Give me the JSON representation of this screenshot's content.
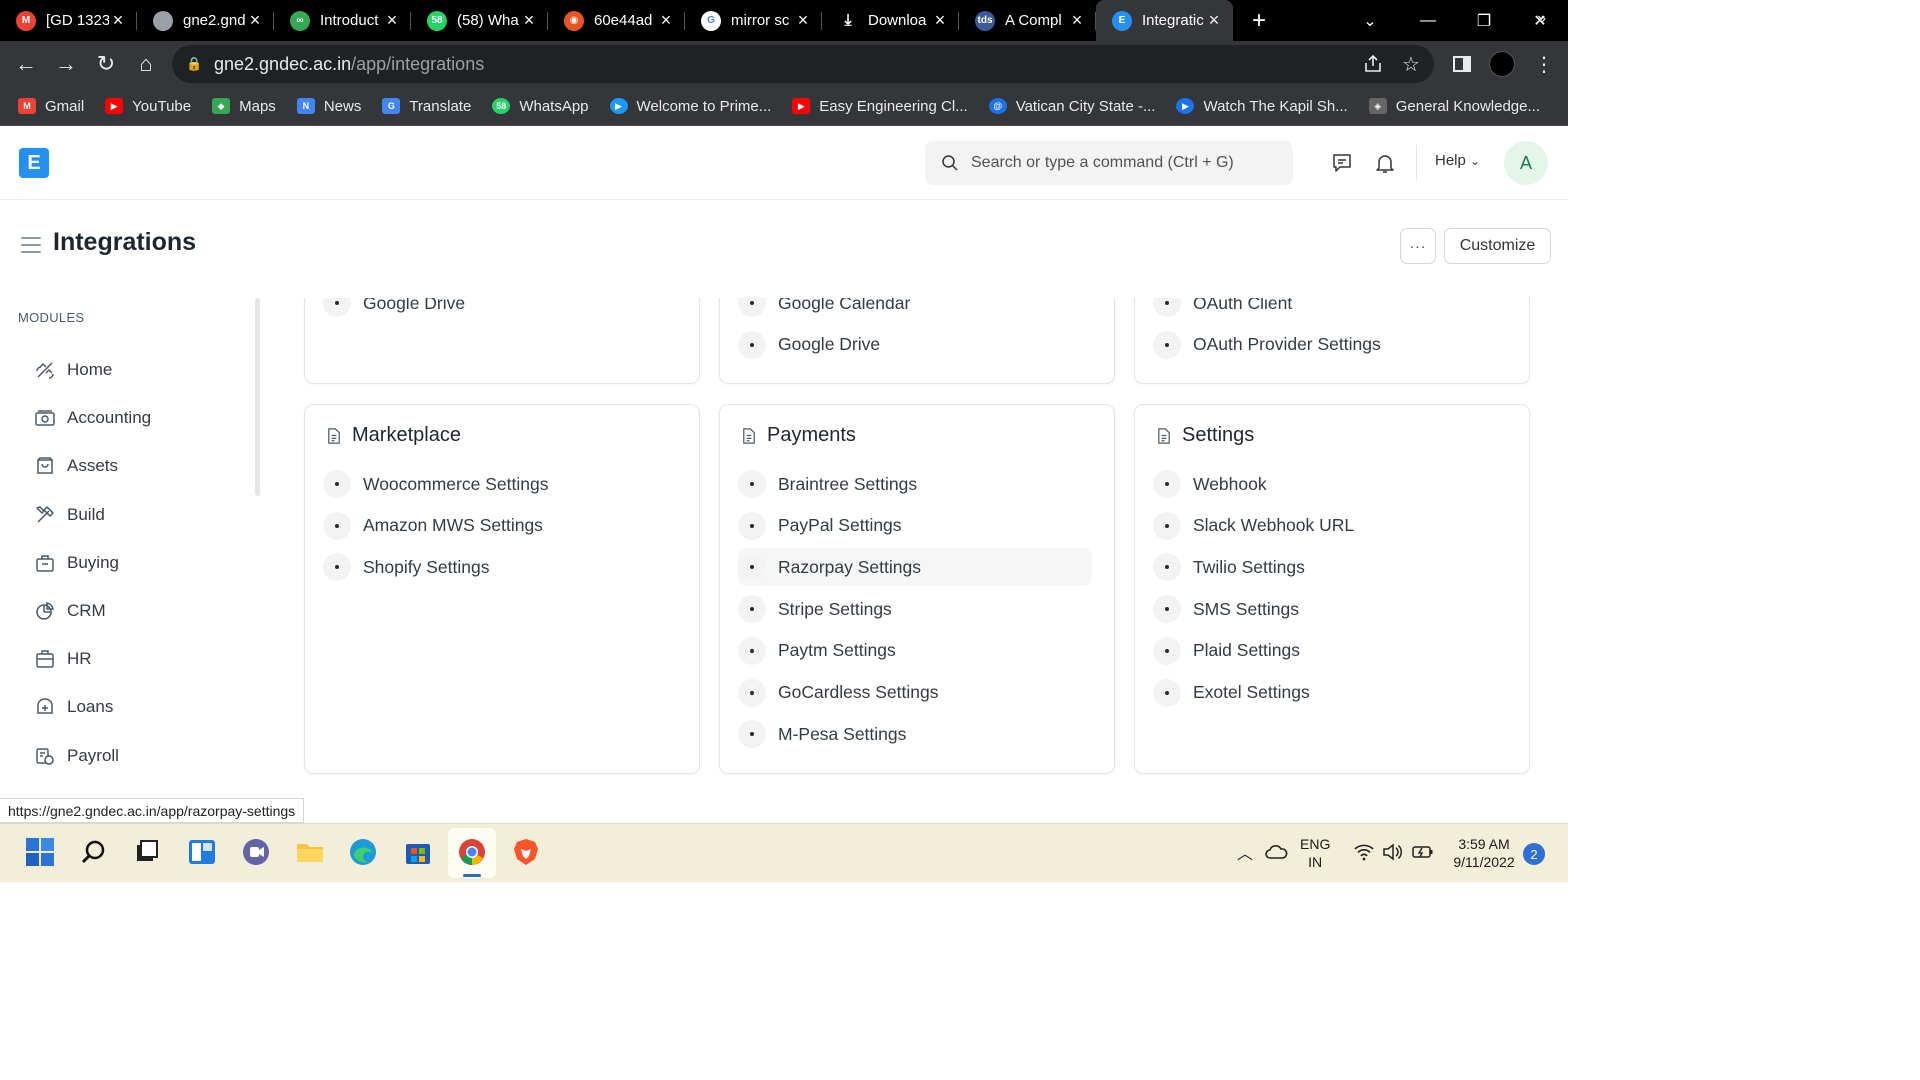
{
  "browser": {
    "tabs": [
      {
        "title": "[GD 1323",
        "icon": "gmail-icon",
        "color": "#ea4335",
        "glyph": "M"
      },
      {
        "title": "gne2.gnd",
        "icon": "globe-icon",
        "color": "#9aa0a6",
        "glyph": ""
      },
      {
        "title": "Introduct",
        "icon": "infinity-icon",
        "color": "#34a853",
        "glyph": "∞"
      },
      {
        "title": "(58) Wha",
        "icon": "whatsapp-icon",
        "color": "#25d366",
        "glyph": "58"
      },
      {
        "title": "60e44ad",
        "icon": "ubuntu-icon",
        "color": "#e95420",
        "glyph": "◉"
      },
      {
        "title": "mirror sc",
        "icon": "google-icon",
        "color": "#ffffff",
        "glyph": "G"
      },
      {
        "title": "Downloa",
        "icon": "download-icon",
        "color": "#000000",
        "glyph": "⤓"
      },
      {
        "title": "A Compl",
        "icon": "tds-icon",
        "color": "#3c5a99",
        "glyph": "tds"
      },
      {
        "title": "Integratic",
        "icon": "erpnext-icon",
        "color": "#2490ef",
        "glyph": "E",
        "active": true
      }
    ],
    "url_host": "gne2.gndec.ac.in",
    "url_path": "/app/integrations",
    "bookmarks": [
      {
        "label": "Gmail",
        "icon": "gmail-icon",
        "color": "#ea4335",
        "glyph": "M"
      },
      {
        "label": "YouTube",
        "icon": "youtube-icon",
        "color": "#ff0000",
        "glyph": "▶"
      },
      {
        "label": "Maps",
        "icon": "maps-icon",
        "color": "#34a853",
        "glyph": "◆"
      },
      {
        "label": "News",
        "icon": "news-icon",
        "color": "#4285f4",
        "glyph": "N"
      },
      {
        "label": "Translate",
        "icon": "translate-icon",
        "color": "#4285f4",
        "glyph": "G"
      },
      {
        "label": "WhatsApp",
        "icon": "whatsapp-icon",
        "color": "#25d366",
        "glyph": "58"
      },
      {
        "label": "Welcome to Prime...",
        "icon": "prime-video-icon",
        "color": "#1a98ff",
        "glyph": "▶"
      },
      {
        "label": "Easy Engineering Cl...",
        "icon": "youtube-icon",
        "color": "#ff0000",
        "glyph": "▶"
      },
      {
        "label": "Vatican City State -...",
        "icon": "at-icon",
        "color": "#1a73e8",
        "glyph": "@"
      },
      {
        "label": "Watch The Kapil Sh...",
        "icon": "play-icon",
        "color": "#1a73e8",
        "glyph": "▶"
      },
      {
        "label": "General Knowledge...",
        "icon": "gk-icon",
        "color": "#666666",
        "glyph": "◈"
      }
    ],
    "bookmarks_more": "»",
    "status_url": "https://gne2.gndec.ac.in/app/razorpay-settings"
  },
  "app": {
    "logo_letter": "E",
    "search_placeholder": "Search or type a command (Ctrl + G)",
    "help_label": "Help",
    "avatar_letter": "A",
    "page_title": "Integrations",
    "more_label": "···",
    "customize_label": "Customize",
    "modules_label": "MODULES",
    "sidebar": [
      {
        "label": "Home",
        "icon": "home-icon"
      },
      {
        "label": "Accounting",
        "icon": "accounting-icon"
      },
      {
        "label": "Assets",
        "icon": "assets-icon"
      },
      {
        "label": "Build",
        "icon": "build-icon"
      },
      {
        "label": "Buying",
        "icon": "buying-icon"
      },
      {
        "label": "CRM",
        "icon": "crm-icon"
      },
      {
        "label": "HR",
        "icon": "hr-icon"
      },
      {
        "label": "Loans",
        "icon": "loans-icon"
      },
      {
        "label": "Payroll",
        "icon": "payroll-icon"
      }
    ],
    "cards_top": [
      {
        "links": [
          "Google Drive"
        ]
      },
      {
        "links": [
          "Google Calendar",
          "Google Drive"
        ]
      },
      {
        "links": [
          "OAuth Client",
          "OAuth Provider Settings"
        ]
      }
    ],
    "cards": [
      {
        "title": "Marketplace",
        "links": [
          "Woocommerce Settings",
          "Amazon MWS Settings",
          "Shopify Settings"
        ]
      },
      {
        "title": "Payments",
        "links": [
          "Braintree Settings",
          "PayPal Settings",
          "Razorpay Settings",
          "Stripe Settings",
          "Paytm Settings",
          "GoCardless Settings",
          "M-Pesa Settings"
        ],
        "hover_index": 2
      },
      {
        "title": "Settings",
        "links": [
          "Webhook",
          "Slack Webhook URL",
          "Twilio Settings",
          "SMS Settings",
          "Plaid Settings",
          "Exotel Settings"
        ]
      }
    ]
  },
  "taskbar": {
    "lang_top": "ENG",
    "lang_bottom": "IN",
    "time": "3:59 AM",
    "date": "9/11/2022",
    "notification_count": "2"
  }
}
